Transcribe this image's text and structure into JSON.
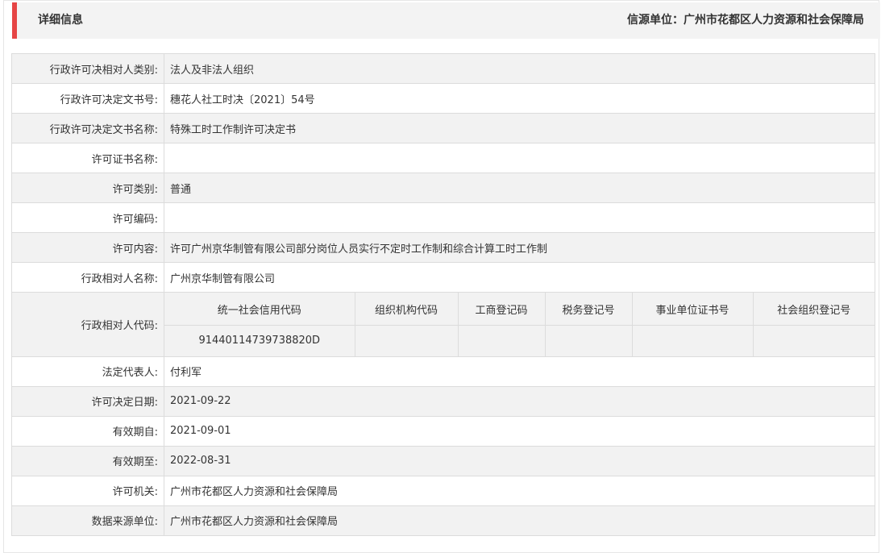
{
  "header": {
    "title": "详细信息",
    "source": "信源单位：广州市花都区人力资源和社会保障局"
  },
  "rows": [
    {
      "label": "行政许可决相对人类别:",
      "value": "法人及非法人组织"
    },
    {
      "label": "行政许可决定文书号:",
      "value": "穗花人社工时决〔2021〕54号"
    },
    {
      "label": "行政许可决定文书名称:",
      "value": "特殊工时工作制许可决定书"
    },
    {
      "label": "许可证书名称:",
      "value": ""
    },
    {
      "label": "许可类别:",
      "value": "普通"
    },
    {
      "label": "许可编码:",
      "value": ""
    },
    {
      "label": "许可内容:",
      "value": "许可广州京华制管有限公司部分岗位人员实行不定时工作制和综合计算工时工作制"
    },
    {
      "label": "行政相对人名称:",
      "value": "广州京华制管有限公司"
    }
  ],
  "code_row": {
    "label": "行政相对人代码:",
    "headers": [
      "统一社会信用代码",
      "组织机构代码",
      "工商登记码",
      "税务登记号",
      "事业单位证书号",
      "社会组织登记号"
    ],
    "values": [
      "91440114739738820D",
      "",
      "",
      "",
      "",
      ""
    ]
  },
  "rows2": [
    {
      "label": "法定代表人:",
      "value": "付利军"
    },
    {
      "label": "许可决定日期:",
      "value": "2021-09-22"
    },
    {
      "label": "有效期自:",
      "value": "2021-09-01"
    },
    {
      "label": "有效期至:",
      "value": "2022-08-31"
    },
    {
      "label": "许可机关:",
      "value": "广州市花都区人力资源和社会保障局"
    },
    {
      "label": "数据来源单位:",
      "value": "广州市花都区人力资源和社会保障局"
    }
  ],
  "colors": {
    "accent": "#e64545",
    "row_alt": "#f2f2f2",
    "border": "#dcdcdc"
  }
}
